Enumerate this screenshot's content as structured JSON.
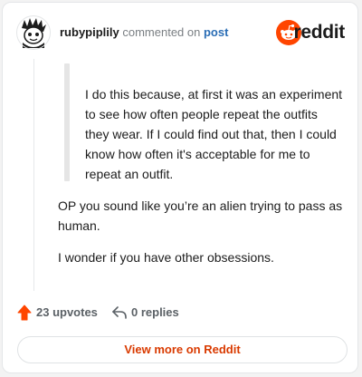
{
  "header": {
    "username": "rubypiplily",
    "verb": "commented on",
    "post_link": "post",
    "brand_name": "reddit",
    "avatar_icon": "snoo-avatar-icon",
    "brand_icon": "reddit-logo-icon"
  },
  "comment": {
    "quote": "I do this because, at first it was an experiment to see how often people repeat the outfits they wear. If I could find out that, then I could know how often it's acceptable for me to repeat an outfit.",
    "paragraphs": [
      "OP you sound like you’re an alien trying to pass as human.",
      "I wonder if you have other obsessions."
    ]
  },
  "actions": {
    "upvotes": "23 upvotes",
    "replies": "0 replies",
    "upvote_icon": "upvote-arrow-icon",
    "reply_icon": "reply-arrow-icon"
  },
  "footer": {
    "view_more": "View more on Reddit"
  },
  "colors": {
    "brand_orange": "#ff4500",
    "link_blue": "#2a6db5",
    "cta_text": "#d93a00"
  }
}
